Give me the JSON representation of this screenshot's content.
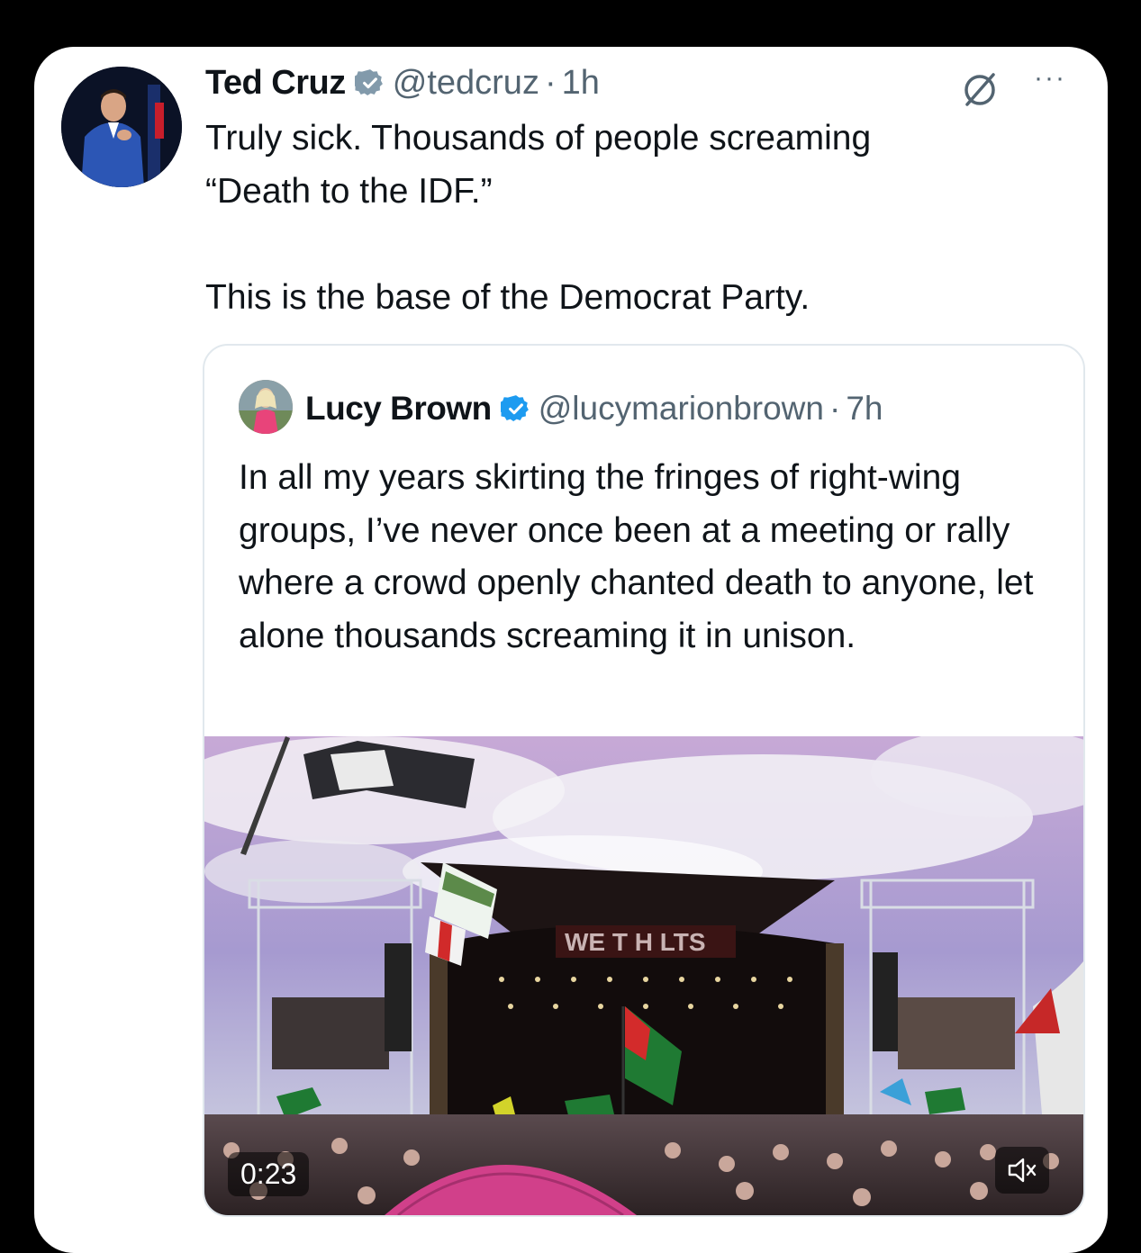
{
  "tweet": {
    "author_name": "Ted Cruz",
    "author_handle": "@tedcruz",
    "separator": "·",
    "time": "1h",
    "text": "Truly sick. Thousands of people screaming\n“Death to the IDF.”\n\nThis is the base of the Democrat Party.",
    "more_label": "···"
  },
  "quoted_tweet": {
    "author_name": "Lucy Brown",
    "author_handle": "@lucymarionbrown",
    "separator": "·",
    "time": "7h",
    "text": "In all my years skirting the fringes of right-wing groups, I’ve never once been at a meeting or rally where a crowd openly chanted death to anyone, let alone thousands screaming it in unison.",
    "video": {
      "duration": "0:23",
      "stage_banner": "WE  T H  LTS",
      "mute_icon": "speaker-muted-icon"
    }
  },
  "colors": {
    "verified": "#1d9bf0",
    "text": "#0f1419",
    "secondary": "#536471"
  }
}
